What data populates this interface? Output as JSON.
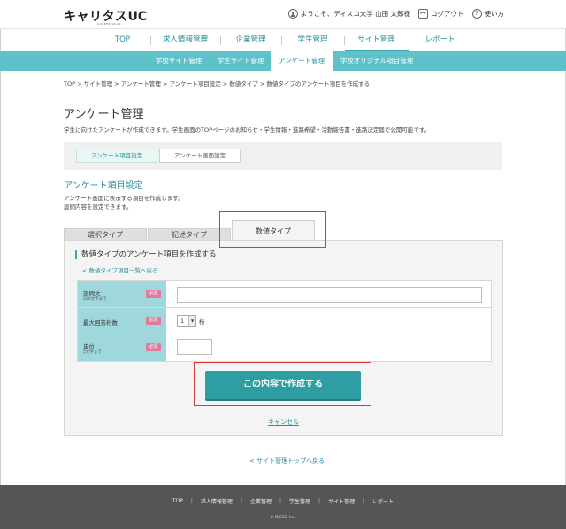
{
  "header": {
    "logo_main": "キャリタス",
    "logo_uc": "UC",
    "logo_sub": "CAREERTASUC",
    "welcome_text": "ようこそ、ディスコ大学 山田 太郎様",
    "logout_label": "ログアウト",
    "help_label": "使い方"
  },
  "main_nav": {
    "items": [
      {
        "label": "TOP"
      },
      {
        "label": "求人情報管理"
      },
      {
        "label": "企業管理"
      },
      {
        "label": "学生管理"
      },
      {
        "label": "サイト管理"
      },
      {
        "label": "レポート"
      }
    ],
    "active": "サイト管理"
  },
  "sub_nav": {
    "items": [
      {
        "label": "学校サイト管理"
      },
      {
        "label": "学生サイト管理"
      },
      {
        "label": "アンケート管理"
      },
      {
        "label": "学校オリジナル項目管理"
      }
    ],
    "active": "アンケート管理"
  },
  "breadcrumb": "TOP > サイト管理 > アンケート管理 > アンケート項目設定 > 数値タイプ > 数値タイプのアンケート項目を作成する",
  "page": {
    "title": "アンケート管理",
    "description": "学生に向けたアンケートが作成できます。学生画面のTOPページのお知らせ・学生情報・進路希望・活動報告書・進路決定届で公開可能です。"
  },
  "setting_tabs": [
    {
      "label": "アンケート項目設定"
    },
    {
      "label": "アンケート画面設定"
    }
  ],
  "section": {
    "title": "アンケート項目設定",
    "desc_line1": "アンケート画面に表示する項目を作成します。",
    "desc_line2": "設問内容を設定できます。"
  },
  "type_tabs": [
    {
      "label": "選択タイプ"
    },
    {
      "label": "記述タイプ"
    },
    {
      "label": "数値タイプ"
    }
  ],
  "panel": {
    "title": "数値タイプのアンケート項目を作成する",
    "back_link": "< 数値タイプ項目一覧へ戻る"
  },
  "form": {
    "question": {
      "label": "設問文",
      "sub": "200文字まで",
      "required": "必須",
      "value": ""
    },
    "max_digits": {
      "label": "最大回答桁数",
      "required": "必須",
      "selected": "1",
      "unit": "桁"
    },
    "unit": {
      "label": "単位",
      "sub": "5文字まで",
      "required": "必須",
      "value": ""
    }
  },
  "buttons": {
    "submit": "この内容で作成する",
    "cancel": "キャンセル"
  },
  "back_to_top": "< サイト管理トップへ戻る",
  "footer": {
    "items": [
      {
        "label": "TOP"
      },
      {
        "label": "求人情報管理"
      },
      {
        "label": "企業管理"
      },
      {
        "label": "学生管理"
      },
      {
        "label": "サイト管理"
      },
      {
        "label": "レポート"
      }
    ],
    "copyright": "© DISCO Inc."
  },
  "colors": {
    "accent": "#3aa7b1",
    "subnav": "#5fc1c9",
    "button": "#2e9ea2",
    "required_badge": "#e07c9a",
    "highlight": "#d63a3a",
    "footer": "#555555"
  }
}
